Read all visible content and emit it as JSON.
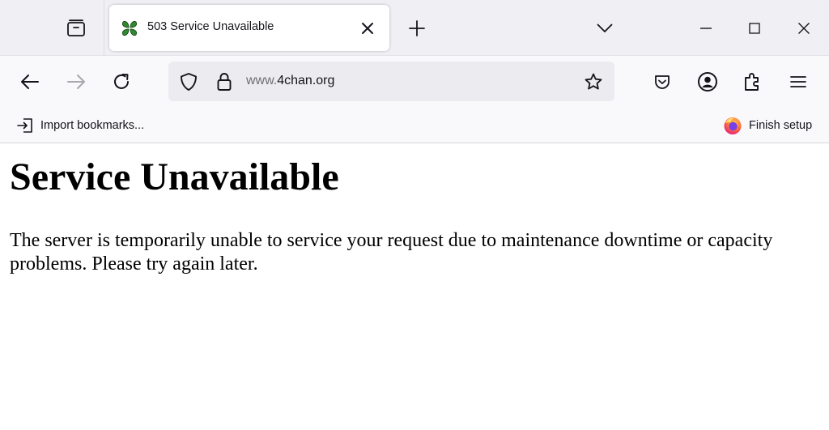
{
  "tab": {
    "title": "503 Service Unavailable"
  },
  "urlbar": {
    "url_prefix": "www.",
    "url_domain": "4chan.org"
  },
  "bookmarks": {
    "import_label": "Import bookmarks...",
    "finish_setup_label": "Finish setup"
  },
  "page": {
    "heading": "Service Unavailable",
    "message": "The server is temporarily unable to service your request due to maintenance downtime or capacity problems. Please try again later."
  },
  "colors": {
    "tabstrip_bg": "#f0f0f4",
    "toolbar_bg": "#f9f9fb",
    "urlbar_bg": "#ececf0",
    "favicon_green": "#2f8a2f",
    "firefox_orange": "#ff7139"
  },
  "icons": {
    "tab_manager": "firefox-view-icon",
    "new_tab": "plus-icon",
    "tab_list": "chevron-down-icon",
    "minimize": "minimize-icon",
    "maximize": "maximize-icon",
    "close": "close-icon",
    "back": "back-arrow-icon",
    "forward": "forward-arrow-icon",
    "reload": "reload-icon",
    "shield": "tracking-shield-icon",
    "lock": "lock-icon",
    "bookmark": "star-icon",
    "pocket": "pocket-icon",
    "account": "account-icon",
    "extensions": "puzzle-icon",
    "menu": "hamburger-menu-icon"
  }
}
